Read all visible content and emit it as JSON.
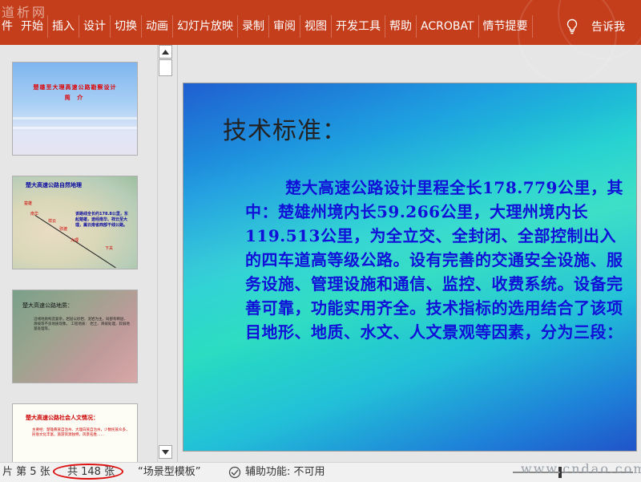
{
  "ribbon": {
    "watermark": "道析网",
    "file_tab_fragment": "件",
    "tabs": [
      "开始",
      "插入",
      "设计",
      "切换",
      "动画",
      "幻灯片放映",
      "录制",
      "审阅",
      "视图",
      "开发工具",
      "帮助",
      "ACROBAT",
      "情节提要"
    ],
    "tell_me": "告诉我"
  },
  "thumbnails": [
    {
      "title": "楚雄至大理高速公路勘察设计",
      "subtitle": "简    介"
    },
    {
      "title": "楚大高速公路自然地理",
      "box": "该路线全长约178.8公里，东起楚雄，途经南华、祥云至大理，属云南省西部干线公路。",
      "points": [
        "楚雄",
        "南华",
        "祥云",
        "弥渡",
        "大理",
        "下关"
      ]
    },
    {
      "title": "楚大高速公路地质：",
      "body": "沿线地质构造复杂，岩层以砂岩、泥岩为主，局部有断层、滑坡等不良地质现象。\n工程地质：\n岩土、滑坡处理，软弱地基处理等。"
    },
    {
      "title": "楚大高速公路社会人文情况：",
      "body": "主要经：楚雄彝族自治州、大理白族自治州，少数民族众多，民俗文化丰富，旅游资源独特，风景名胜……"
    }
  ],
  "slide": {
    "heading": "技术标准：",
    "body": "楚大高速公路设计里程全长178.779公里，其中：楚雄州境内长59.266公里，大理州境内长119.513公里，为全立交、全封闭、全部控制出入的四车道高等级公路。设有完善的交通安全设施、服务设施、管理设施和通信、监控、收费系统。设备完善可靠，功能实用齐全。技术指标的选用结合了该项目地形、地质、水文、人文景观等因素，分为三段："
  },
  "status": {
    "slide_info": "片 第 5 张",
    "total": "共 148 张",
    "template": "“场景型模板”",
    "accessibility": "辅助功能: 不可用",
    "watermark": "www.cndao.com"
  }
}
